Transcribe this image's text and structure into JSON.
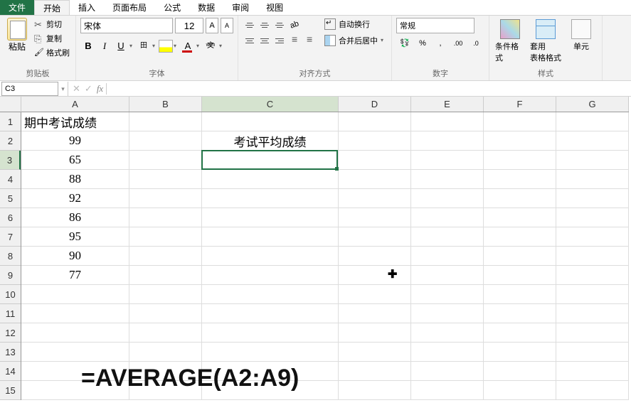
{
  "tabs": {
    "file": "文件",
    "home": "开始",
    "insert": "插入",
    "layout": "页面布局",
    "formula": "公式",
    "data": "数据",
    "review": "审阅",
    "view": "视图"
  },
  "ribbon": {
    "clipboard": {
      "label": "剪贴板",
      "paste": "粘贴",
      "cut": "剪切",
      "copy": "复制",
      "painter": "格式刷"
    },
    "font": {
      "label": "字体",
      "name": "宋体",
      "size": "12"
    },
    "align": {
      "label": "对齐方式",
      "wrap": "自动换行",
      "merge": "合并后居中"
    },
    "number": {
      "label": "数字",
      "format": "常规"
    },
    "styles": {
      "label": "样式",
      "cond": "条件格式",
      "table": "套用\n表格格式",
      "cell": "单元"
    }
  },
  "formula_bar": {
    "name_box": "C3",
    "formula": ""
  },
  "columns": [
    "A",
    "B",
    "C",
    "D",
    "E",
    "F",
    "G"
  ],
  "rows": [
    "1",
    "2",
    "3",
    "4",
    "5",
    "6",
    "7",
    "8",
    "9",
    "10",
    "11",
    "12",
    "13",
    "14",
    "15"
  ],
  "active_cell": {
    "col": "C",
    "row": 3
  },
  "cells": {
    "A1": "期中考试成绩",
    "A2": "99",
    "A3": "65",
    "A4": "88",
    "A5": "92",
    "A6": "86",
    "A7": "95",
    "A8": "90",
    "A9": "77",
    "C2": "考试平均成绩"
  },
  "overlay_formula": "=AVERAGE(A2:A9)",
  "chart_data": {
    "type": "table",
    "title": "期中考试成绩",
    "column_label": "期中考试成绩",
    "values": [
      99,
      65,
      88,
      92,
      86,
      95,
      90,
      77
    ],
    "annotation": "考试平均成绩",
    "formula": "=AVERAGE(A2:A9)"
  }
}
